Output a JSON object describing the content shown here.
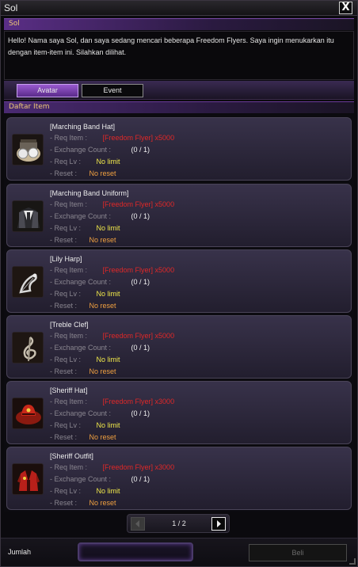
{
  "window": {
    "title": "Sol",
    "close_label": "X"
  },
  "npc": {
    "name": "Sol",
    "dialog": "Hello! Nama saya Sol, dan saya sedang mencari beberapa Freedom Flyers. Saya ingin menukarkan itu dengan item-item ini. Silahkan dilihat."
  },
  "tabs": [
    {
      "label": "Avatar",
      "active": true
    },
    {
      "label": "Event",
      "active": false
    }
  ],
  "list_header": "Daftar Item",
  "labels": {
    "req_item": "- Req Item :",
    "exchange_count": "- Exchange Count :",
    "req_lv": "- Req Lv :",
    "reset": "- Reset :"
  },
  "items": [
    {
      "name": "[Marching Band Hat]",
      "req_item": "[Freedom Flyer]",
      "req_qty": "x5000",
      "exchange_count": "(0 / 1)",
      "req_lv": "No limit",
      "reset": "No reset",
      "icon": "marching-band-hat-icon"
    },
    {
      "name": "[Marching Band Uniform]",
      "req_item": "[Freedom Flyer]",
      "req_qty": "x5000",
      "exchange_count": "(0 / 1)",
      "req_lv": "No limit",
      "reset": "No reset",
      "icon": "marching-band-uniform-icon"
    },
    {
      "name": "[Lily Harp]",
      "req_item": "[Freedom Flyer]",
      "req_qty": "x5000",
      "exchange_count": "(0 / 1)",
      "req_lv": "No limit",
      "reset": "No reset",
      "icon": "lily-harp-icon"
    },
    {
      "name": "[Treble Clef]",
      "req_item": "[Freedom Flyer]",
      "req_qty": "x5000",
      "exchange_count": "(0 / 1)",
      "req_lv": "No limit",
      "reset": "No reset",
      "icon": "treble-clef-icon"
    },
    {
      "name": "[Sheriff Hat]",
      "req_item": "[Freedom Flyer]",
      "req_qty": "x3000",
      "exchange_count": "(0 / 1)",
      "req_lv": "No limit",
      "reset": "No reset",
      "icon": "sheriff-hat-icon"
    },
    {
      "name": "[Sheriff Outfit]",
      "req_item": "[Freedom Flyer]",
      "req_qty": "x3000",
      "exchange_count": "(0 / 1)",
      "req_lv": "No limit",
      "reset": "No reset",
      "icon": "sheriff-outfit-icon"
    }
  ],
  "pagination": {
    "current": 1,
    "total": 2,
    "display": "1 / 2"
  },
  "footer": {
    "quantity_label": "Jumlah",
    "buy_label": "Beli"
  },
  "colors": {
    "req_item": "#e02828",
    "exchange_count": "#f0f0f0",
    "req_lv": "#f0e84a",
    "reset": "#f0a040",
    "header_accent": "#f0c878",
    "tab_active": "#9a5ad0"
  }
}
